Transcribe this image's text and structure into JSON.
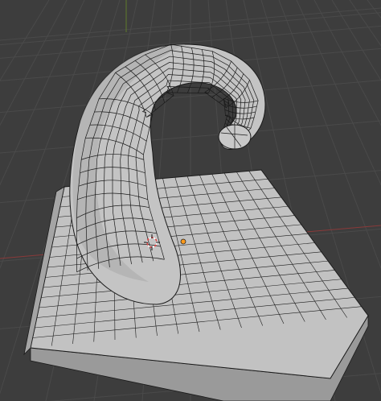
{
  "viewport": {
    "background_color": "#3d3d3d",
    "grid_color": "#4a4a4a",
    "x_axis_color": "#8a3a3a",
    "y_axis_color": "#5f7a2a",
    "mesh_fill": "#bdbdbd",
    "mesh_shadow": "#8f8f8f",
    "wire_color": "#1a1a1a"
  },
  "overlays": {
    "cursor_3d": "3d-cursor-icon",
    "origin": "object-origin-icon",
    "origin_color": "#ff9a1a"
  }
}
